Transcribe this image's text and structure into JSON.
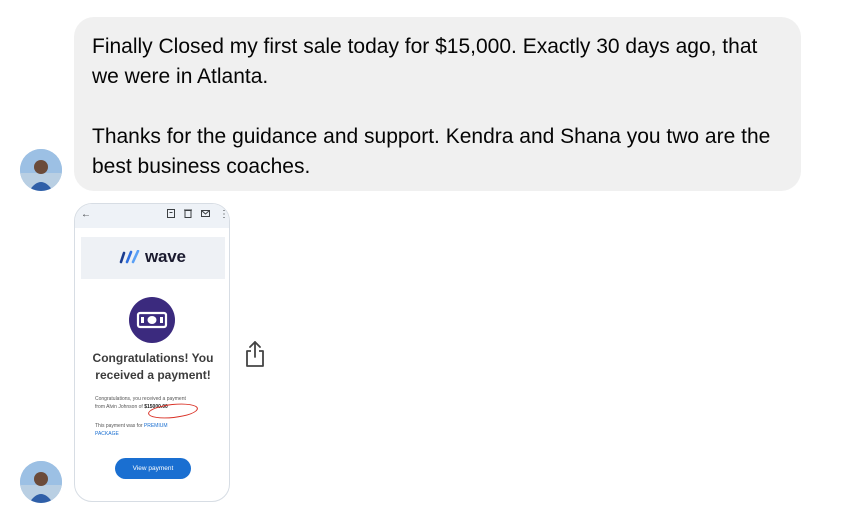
{
  "message": {
    "paragraphs": [
      "Finally Closed my first sale today for $15,000. Exactly 30 days ago, that we were in Atlanta.",
      "Thanks for the guidance and support.  Kendra and Shana you two are the best business coaches."
    ]
  },
  "attachment": {
    "toolbar_icons": [
      "back-arrow-icon",
      "archive-icon",
      "trash-icon",
      "mail-icon",
      "more-vert-icon"
    ],
    "brand": "wave",
    "heading_line1": "Congratulations! You",
    "heading_line2": "received a payment!",
    "body_line1": "Congratulations, you received a payment",
    "body_line2_prefix": "from Alvin Johnson of ",
    "amount": "$15000.00",
    "body_line3_prefix": "This payment was for ",
    "package_line1": "PREMIUM",
    "package_line2": "PACKAGE",
    "button_label": "View payment"
  },
  "colors": {
    "bubble": "#f0f0f0",
    "wave_purple": "#3b2a7e",
    "button_blue": "#1a6fd1",
    "annotation_red": "#d93025"
  }
}
